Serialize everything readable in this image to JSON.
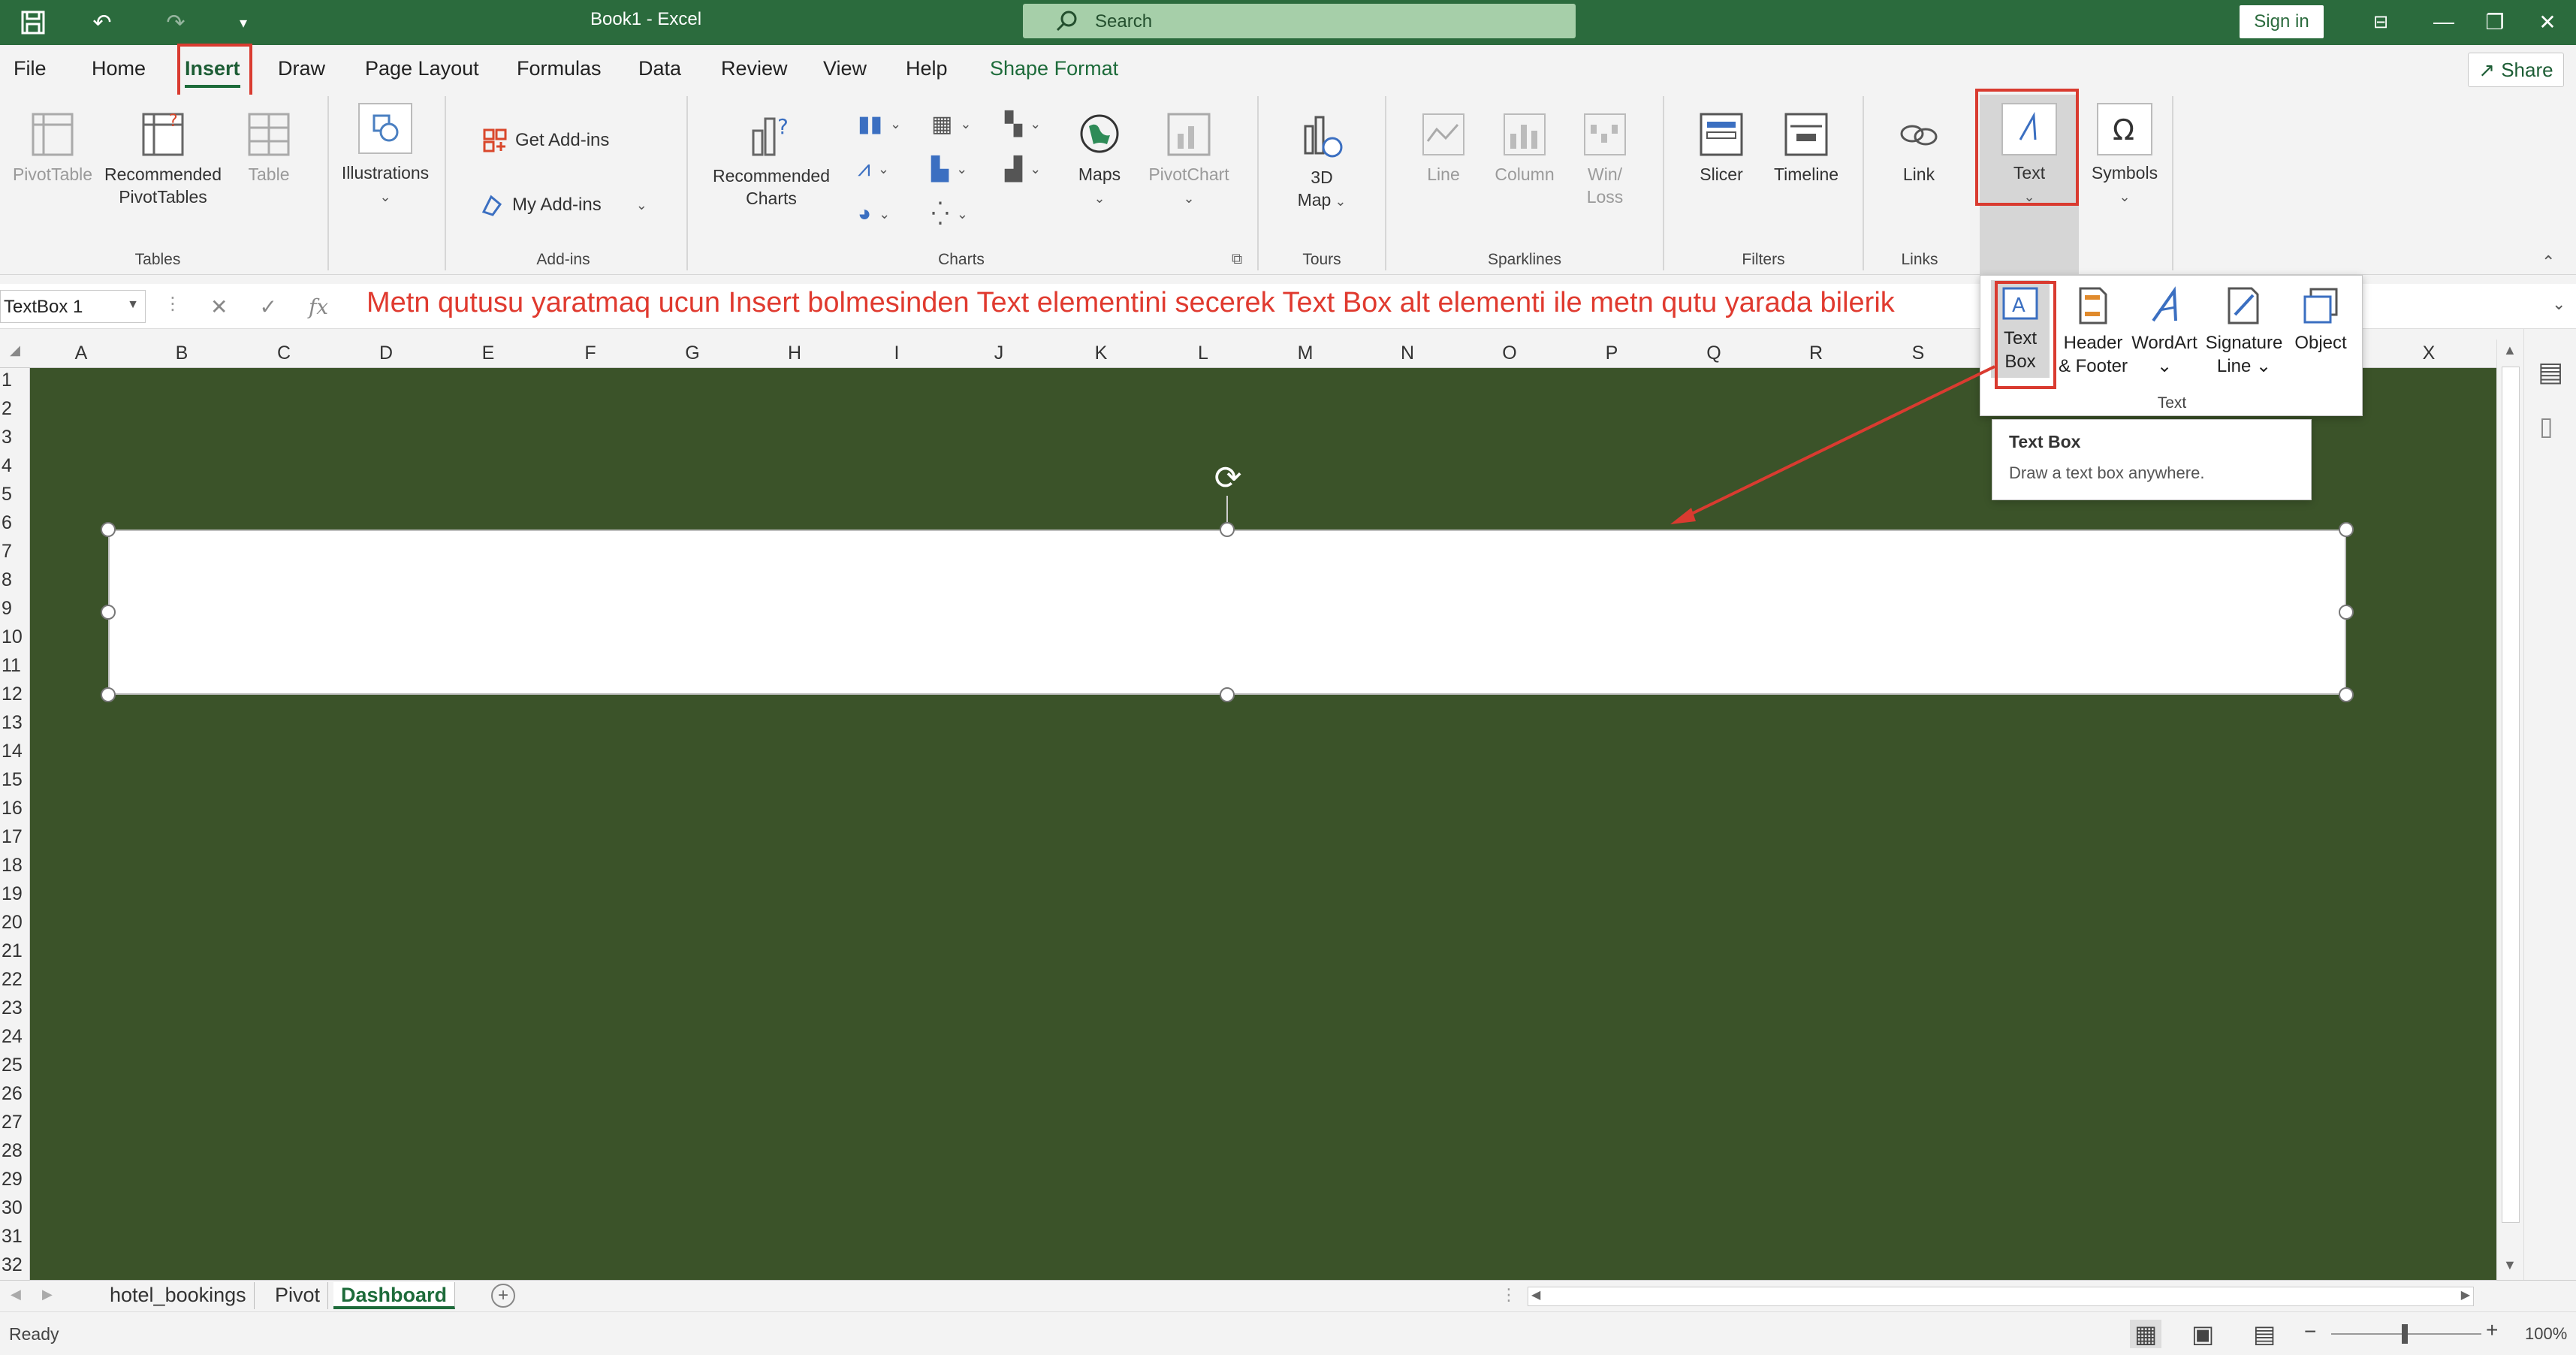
{
  "app": {
    "title": "Book1  -  Excel",
    "search_placeholder": "Search",
    "sign_in": "Sign in",
    "share": "Share"
  },
  "colors": {
    "accent": "#2b6b3d",
    "sheet_bg": "#3b5329",
    "annotation": "#d93b30"
  },
  "menu": {
    "tabs": [
      {
        "label": "File"
      },
      {
        "label": "Home"
      },
      {
        "label": "Insert"
      },
      {
        "label": "Draw"
      },
      {
        "label": "Page Layout"
      },
      {
        "label": "Formulas"
      },
      {
        "label": "Data"
      },
      {
        "label": "Review"
      },
      {
        "label": "View"
      },
      {
        "label": "Help"
      },
      {
        "label": "Shape Format"
      }
    ],
    "active": "Insert"
  },
  "ribbon": {
    "tables": {
      "pivottable": "PivotTable",
      "recommended_l1": "Recommended",
      "recommended_l2": "PivotTables",
      "table": "Table",
      "group": "Tables"
    },
    "illustrations": {
      "label": "Illustrations"
    },
    "addins": {
      "get": "Get Add-ins",
      "my": "My Add-ins",
      "group": "Add-ins"
    },
    "charts": {
      "recommended_l1": "Recommended",
      "recommended_l2": "Charts",
      "maps": "Maps",
      "pivotchart": "PivotChart",
      "group": "Charts"
    },
    "tours": {
      "map_l1": "3D",
      "map_l2": "Map",
      "group": "Tours"
    },
    "sparklines": {
      "line": "Line",
      "column": "Column",
      "winloss_l1": "Win/",
      "winloss_l2": "Loss",
      "group": "Sparklines"
    },
    "filters": {
      "slicer": "Slicer",
      "timeline": "Timeline",
      "group": "Filters"
    },
    "links": {
      "link": "Link",
      "group": "Links"
    },
    "text": {
      "label": "Text"
    },
    "symbols": {
      "label": "Symbols"
    }
  },
  "formula_bar": {
    "name_box": "TextBox 1",
    "fx": "fx",
    "content": "Metn qutusu yaratmaq ucun Insert bolmesinden Text elementini secerek Text Box alt elementi ile metn qutu yarada bilerik"
  },
  "grid": {
    "columns": [
      "A",
      "B",
      "C",
      "D",
      "E",
      "F",
      "G",
      "H",
      "I",
      "J",
      "K",
      "L",
      "M",
      "N",
      "O",
      "P",
      "Q",
      "R",
      "S",
      "T",
      "U",
      "V",
      "W",
      "X"
    ],
    "rows": [
      "1",
      "2",
      "3",
      "4",
      "5",
      "6",
      "7",
      "8",
      "9",
      "10",
      "11",
      "12",
      "13",
      "14",
      "15",
      "16",
      "17",
      "18",
      "19",
      "20",
      "21",
      "22",
      "23",
      "24",
      "25",
      "26",
      "27",
      "28",
      "29",
      "30",
      "31",
      "32"
    ]
  },
  "text_dropdown": {
    "items": [
      {
        "l1": "Text",
        "l2": "Box"
      },
      {
        "l1": "Header",
        "l2": "& Footer"
      },
      {
        "l1": "WordArt",
        "l2": "⌄"
      },
      {
        "l1": "Signature",
        "l2": "Line ⌄"
      },
      {
        "l1": "Object",
        "l2": ""
      }
    ],
    "group": "Text",
    "tooltip_title": "Text Box",
    "tooltip_desc": "Draw a text box anywhere."
  },
  "sheets": {
    "tabs": [
      "hotel_bookings",
      "Pivot",
      "Dashboard"
    ],
    "active": "Dashboard"
  },
  "status": {
    "text": "Ready",
    "zoom": "100%"
  }
}
